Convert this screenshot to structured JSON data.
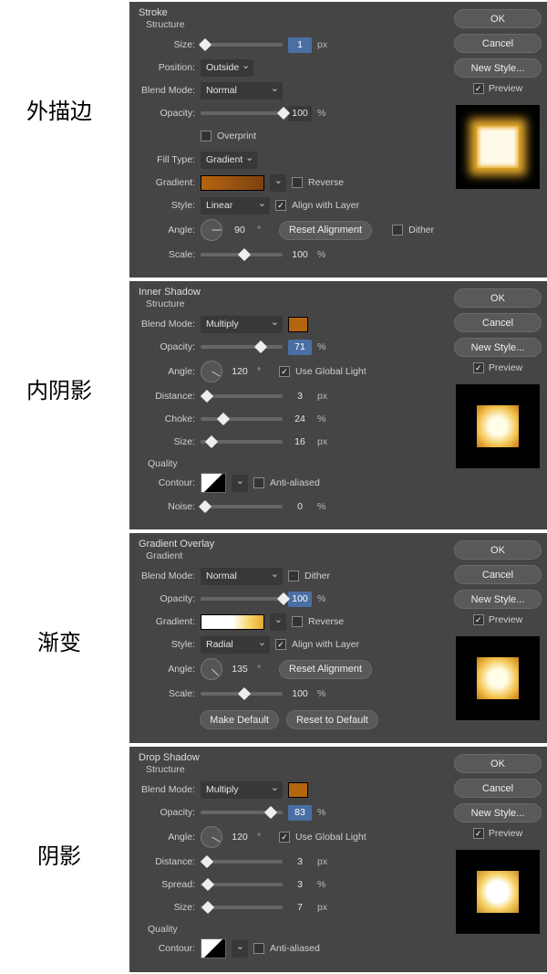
{
  "labels": {
    "ext_stroke": "外描边",
    "inner_shadow": "内阴影",
    "gradient": "渐变",
    "shadow": "阴影"
  },
  "common": {
    "ok": "OK",
    "cancel": "Cancel",
    "new_style": "New Style...",
    "preview": "Preview",
    "blend_mode": "Blend Mode:",
    "opacity": "Opacity:",
    "angle": "Angle:",
    "deg": "°",
    "percent": "%",
    "px": "px",
    "size": "Size:",
    "style": "Style:",
    "reset_align": "Reset Alignment",
    "align_layer": "Align with Layer",
    "reverse": "Reverse",
    "dither": "Dither",
    "gradient": "Gradient:",
    "scale": "Scale:",
    "use_global": "Use Global Light",
    "anti_aliased": "Anti-aliased",
    "contour": "Contour:",
    "noise": "Noise:",
    "distance": "Distance:",
    "quality": "Quality",
    "structure": "Structure"
  },
  "stroke": {
    "title": "Stroke",
    "size": "1",
    "position_lbl": "Position:",
    "position": "Outside",
    "blend": "Normal",
    "opacity": "100",
    "overprint": "Overprint",
    "fill_type_lbl": "Fill Type:",
    "fill_type": "Gradient",
    "style": "Linear",
    "angle": "90",
    "scale": "100"
  },
  "inner": {
    "title": "Inner Shadow",
    "blend": "Multiply",
    "opacity": "71",
    "angle": "120",
    "distance": "3",
    "choke_lbl": "Choke:",
    "choke": "24",
    "size": "16",
    "noise": "0"
  },
  "gradov": {
    "title": "Gradient Overlay",
    "sub": "Gradient",
    "blend": "Normal",
    "opacity": "100",
    "style": "Radial",
    "angle": "135",
    "scale": "100",
    "make_default": "Make Default",
    "reset_default": "Reset to Default"
  },
  "drop": {
    "title": "Drop Shadow",
    "blend": "Multiply",
    "opacity": "83",
    "angle": "120",
    "distance": "3",
    "spread_lbl": "Spread:",
    "spread": "3",
    "size": "7"
  }
}
